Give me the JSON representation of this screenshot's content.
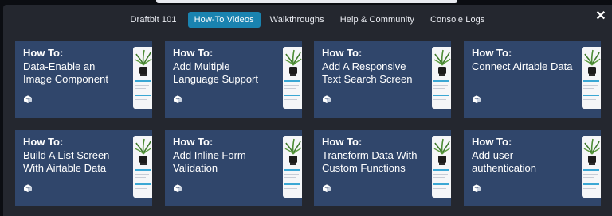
{
  "tabs": [
    {
      "label": "Draftbit 101",
      "active": false
    },
    {
      "label": "How-To Videos",
      "active": true
    },
    {
      "label": "Walkthroughs",
      "active": false
    },
    {
      "label": "Help & Community",
      "active": false
    },
    {
      "label": "Console Logs",
      "active": false
    }
  ],
  "close_icon": "close-icon",
  "card_icon": "cube-icon",
  "colors": {
    "active_tab": "#1a83b0",
    "card_bg": "#30466b",
    "modal_bg": "#24272f"
  },
  "cards": [
    {
      "prefix": "How To:",
      "title": "Data-Enable an Image Component"
    },
    {
      "prefix": "How To:",
      "title": "Add Multiple Language Support"
    },
    {
      "prefix": "How To:",
      "title": "Add A Responsive Text Search Screen"
    },
    {
      "prefix": "How To:",
      "title": "Connect Airtable Data"
    },
    {
      "prefix": "How To:",
      "title": "Build A List Screen With Airtable Data"
    },
    {
      "prefix": "How To:",
      "title": "Add Inline Form Validation"
    },
    {
      "prefix": "How To:",
      "title": "Transform Data With Custom Functions"
    },
    {
      "prefix": "How To:",
      "title": "Add user authentication"
    }
  ]
}
